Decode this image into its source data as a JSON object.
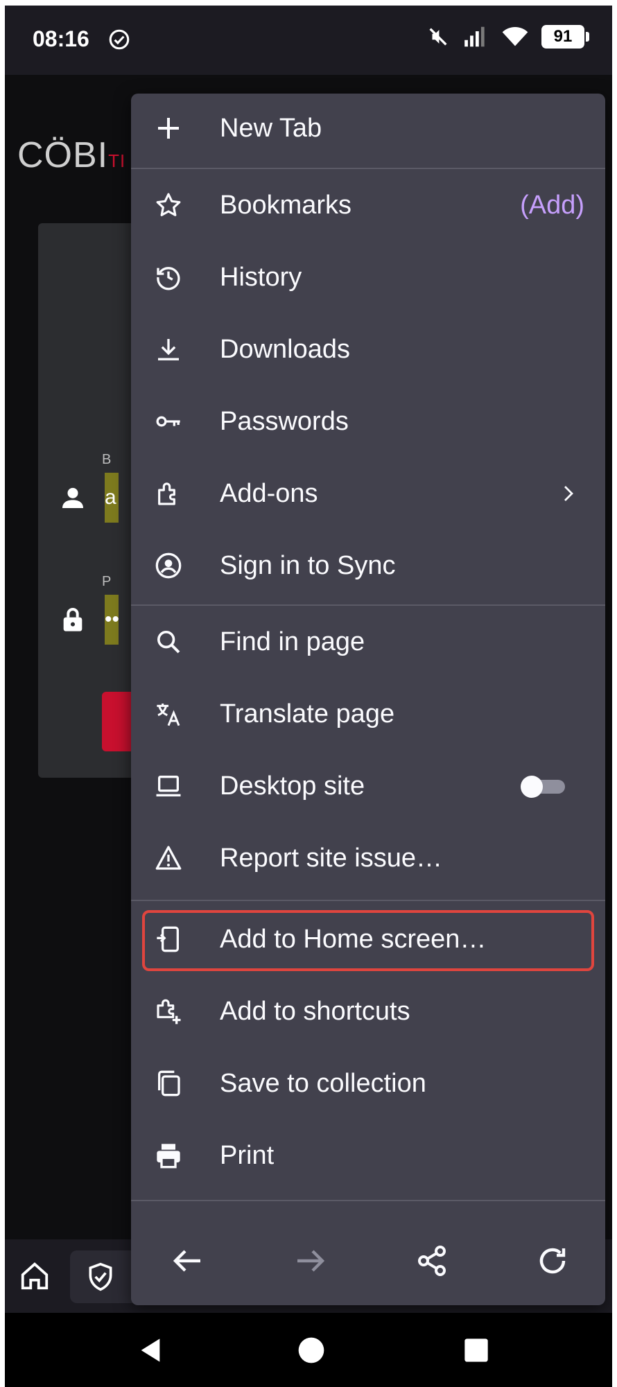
{
  "status_bar": {
    "time": "08:16",
    "battery": "91"
  },
  "background_page": {
    "logo_text": "CÖBI",
    "logo_suffix": "TI",
    "username_label": "B",
    "username_value": "a",
    "password_label": "P",
    "password_value": "••"
  },
  "menu": {
    "items": [
      {
        "label": "New Tab",
        "icon": "plus-icon"
      },
      {
        "label": "Bookmarks",
        "icon": "star-icon",
        "extra": "(Add)"
      },
      {
        "label": "History",
        "icon": "history-icon"
      },
      {
        "label": "Downloads",
        "icon": "download-icon"
      },
      {
        "label": "Passwords",
        "icon": "key-icon"
      },
      {
        "label": "Add-ons",
        "icon": "puzzle-icon"
      },
      {
        "label": "Sign in to Sync",
        "icon": "account-icon"
      },
      {
        "label": "Find in page",
        "icon": "search-icon"
      },
      {
        "label": "Translate page",
        "icon": "translate-icon"
      },
      {
        "label": "Desktop site",
        "icon": "laptop-icon",
        "toggle": false
      },
      {
        "label": "Report site issue…",
        "icon": "warning-icon"
      },
      {
        "label": "Add to Home screen…",
        "icon": "add-to-home-icon",
        "highlighted": true
      },
      {
        "label": "Add to shortcuts",
        "icon": "add-shortcut-icon"
      },
      {
        "label": "Save to collection",
        "icon": "collection-icon"
      },
      {
        "label": "Print",
        "icon": "printer-icon"
      }
    ],
    "nav_icons": [
      "back-arrow-icon",
      "forward-arrow-icon",
      "share-icon",
      "reload-icon"
    ]
  },
  "colors": {
    "menu_bg": "#42414d",
    "accent_link": "#c69ffc",
    "highlight_border": "#e0453e"
  }
}
